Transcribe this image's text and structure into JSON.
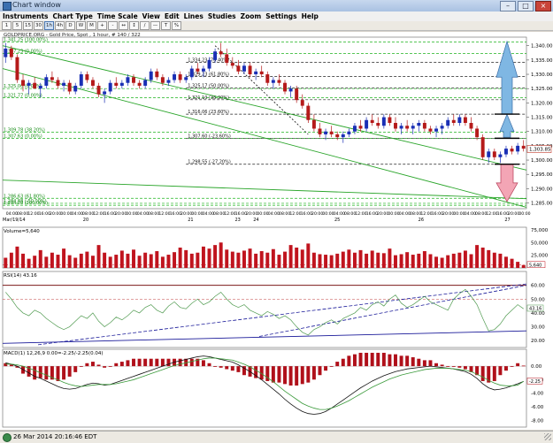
{
  "window": {
    "title": "Chart window",
    "buttons": [
      "–",
      "□",
      "×"
    ]
  },
  "menu": [
    "Instruments",
    "Chart Type",
    "Time Scale",
    "View",
    "Edit",
    "Lines",
    "Studies",
    "Zoom",
    "Settings",
    "Help"
  ],
  "toolbar": {
    "buttons": [
      "1",
      "5",
      "15",
      "30",
      "1h",
      "4h",
      "D",
      "W",
      "M",
      "+",
      "-",
      "↔",
      "↕",
      "/",
      "—",
      "T",
      "%"
    ],
    "selected": "1h"
  },
  "chart_data": [
    {
      "type": "candlestick",
      "title": "GOLDPRICE.ORG - Gold Price, Spot , 1 hour, # 140 / 322",
      "ylim": [
        1283,
        1343
      ],
      "yticks": [
        "1,340.00",
        "1,335.00",
        "1,330.00",
        "1,325.00",
        "1,320.00",
        "1,315.00",
        "1,310.00",
        "1,305.00",
        "1,300.00",
        "1,295.00",
        "1,290.00",
        "1,285.00"
      ],
      "ytick_values": [
        1340,
        1335,
        1330,
        1325,
        1320,
        1315,
        1310,
        1305,
        1300,
        1295,
        1290,
        1285
      ],
      "last_price": "1,303.85",
      "last_price_value": 1303.85,
      "x_ticks": [
        "04:00",
        "08:00",
        "12:00",
        "16:00",
        "20:00",
        "00:00",
        "04:00",
        "08:00",
        "12:00",
        "16:00",
        "20:00",
        "00:00",
        "04:00",
        "08:00",
        "12:00",
        "16:00",
        "20:00",
        "00:00",
        "04:00",
        "08:00",
        "12:00",
        "16:00",
        "20:00",
        "00:00",
        "04:00",
        "08:00",
        "12:00",
        "16:00",
        "20:00",
        "00:00",
        "04:00",
        "08:00",
        "12:00",
        "16:00",
        "20:00",
        "00:00",
        "04:00",
        "08:00",
        "12:00",
        "16:00",
        "20:00",
        "00:00",
        "04:00",
        "08:00",
        "12:00",
        "16:00",
        "20:00",
        "00:00"
      ],
      "date_labels": [
        "Mar/19/14",
        "20",
        "21",
        "23",
        "24",
        "25",
        "26",
        "27"
      ],
      "fib_lines": [
        {
          "value": 1341.25,
          "label": "1,341.25 (100.00%)"
        },
        {
          "value": 1337.23,
          "label": "1,337.23 (0.00%)"
        },
        {
          "value": 1334.23,
          "label": "1,334.23 (76.40%)"
        },
        {
          "value": 1329.23,
          "label": "1,329.23 (61.80%)"
        },
        {
          "value": 1325.17,
          "label": "1,325.17 (50.00%)"
        },
        {
          "value": 1325.0,
          "label": "1,325.00 (0.00%)"
        },
        {
          "value": 1321.77,
          "label": "1,321.77 (0.00%)"
        },
        {
          "value": 1321.1,
          "label": "1,321.10 (38.20%)"
        },
        {
          "value": 1316.06,
          "label": "1,316.06 (23.60%)"
        },
        {
          "value": 1309.78,
          "label": "1,309.78 (38.20%)"
        },
        {
          "value": 1307.63,
          "label": "1,307.63 (0.00%)"
        },
        {
          "value": 1307.6,
          "label": "1,307.60 (-23.60%)"
        },
        {
          "value": 1298.55,
          "label": "1,298.55 (-27.20%)"
        },
        {
          "value": 1286.63,
          "label": "1,286.63 (61.80%)"
        },
        {
          "value": 1284.88,
          "label": "1,284.88 (-50.00%)"
        },
        {
          "value": 1284.2,
          "label": "1,284.20 (100.00%)"
        }
      ],
      "candles": [
        [
          1336,
          1341,
          1334,
          1339
        ],
        [
          1339,
          1340,
          1335,
          1336
        ],
        [
          1336,
          1337,
          1327,
          1328
        ],
        [
          1328,
          1330,
          1324,
          1326
        ],
        [
          1326,
          1328,
          1323,
          1327
        ],
        [
          1327,
          1329,
          1325,
          1325
        ],
        [
          1325,
          1327,
          1322,
          1326
        ],
        [
          1326,
          1330,
          1325,
          1329
        ],
        [
          1329,
          1331,
          1327,
          1328
        ],
        [
          1328,
          1329,
          1325,
          1326
        ],
        [
          1326,
          1328,
          1324,
          1327
        ],
        [
          1327,
          1328,
          1323,
          1324
        ],
        [
          1324,
          1327,
          1323,
          1326
        ],
        [
          1326,
          1331,
          1325,
          1330
        ],
        [
          1330,
          1331,
          1327,
          1328
        ],
        [
          1328,
          1329,
          1325,
          1326
        ],
        [
          1326,
          1327,
          1322,
          1323
        ],
        [
          1323,
          1325,
          1320,
          1324
        ],
        [
          1324,
          1328,
          1323,
          1327
        ],
        [
          1327,
          1329,
          1325,
          1326
        ],
        [
          1326,
          1328,
          1325,
          1327
        ],
        [
          1327,
          1330,
          1326,
          1329
        ],
        [
          1329,
          1330,
          1326,
          1327
        ],
        [
          1327,
          1328,
          1325,
          1326
        ],
        [
          1326,
          1329,
          1325,
          1328
        ],
        [
          1328,
          1332,
          1327,
          1331
        ],
        [
          1331,
          1332,
          1328,
          1329
        ],
        [
          1329,
          1330,
          1326,
          1327
        ],
        [
          1327,
          1329,
          1326,
          1328
        ],
        [
          1328,
          1331,
          1327,
          1330
        ],
        [
          1330,
          1331,
          1327,
          1328
        ],
        [
          1328,
          1330,
          1327,
          1329
        ],
        [
          1329,
          1333,
          1328,
          1332
        ],
        [
          1332,
          1334,
          1330,
          1331
        ],
        [
          1331,
          1333,
          1329,
          1332
        ],
        [
          1332,
          1336,
          1331,
          1335
        ],
        [
          1335,
          1339,
          1334,
          1338
        ],
        [
          1338,
          1341,
          1336,
          1337
        ],
        [
          1337,
          1339,
          1333,
          1334
        ],
        [
          1334,
          1336,
          1332,
          1333
        ],
        [
          1333,
          1335,
          1330,
          1331
        ],
        [
          1331,
          1334,
          1330,
          1333
        ],
        [
          1333,
          1334,
          1329,
          1330
        ],
        [
          1330,
          1332,
          1328,
          1331
        ],
        [
          1331,
          1333,
          1329,
          1330
        ],
        [
          1330,
          1331,
          1326,
          1327
        ],
        [
          1327,
          1329,
          1325,
          1328
        ],
        [
          1328,
          1330,
          1326,
          1327
        ],
        [
          1327,
          1328,
          1323,
          1324
        ],
        [
          1324,
          1326,
          1322,
          1325
        ],
        [
          1325,
          1326,
          1320,
          1321
        ],
        [
          1321,
          1323,
          1318,
          1319
        ],
        [
          1319,
          1320,
          1313,
          1314
        ],
        [
          1314,
          1316,
          1310,
          1311
        ],
        [
          1311,
          1313,
          1308,
          1309
        ],
        [
          1309,
          1311,
          1307,
          1310
        ],
        [
          1310,
          1312,
          1308,
          1309
        ],
        [
          1309,
          1310,
          1307,
          1308
        ],
        [
          1308,
          1310,
          1306,
          1309
        ],
        [
          1309,
          1311,
          1308,
          1310
        ],
        [
          1310,
          1313,
          1309,
          1312
        ],
        [
          1312,
          1314,
          1310,
          1311
        ],
        [
          1311,
          1315,
          1310,
          1314
        ],
        [
          1314,
          1316,
          1312,
          1313
        ],
        [
          1313,
          1315,
          1311,
          1312
        ],
        [
          1312,
          1316,
          1311,
          1315
        ],
        [
          1315,
          1316,
          1312,
          1313
        ],
        [
          1313,
          1315,
          1310,
          1311
        ],
        [
          1311,
          1313,
          1309,
          1312
        ],
        [
          1312,
          1314,
          1310,
          1311
        ],
        [
          1311,
          1313,
          1309,
          1312
        ],
        [
          1312,
          1314,
          1310,
          1313
        ],
        [
          1313,
          1314,
          1310,
          1311
        ],
        [
          1311,
          1312,
          1309,
          1310
        ],
        [
          1310,
          1312,
          1308,
          1311
        ],
        [
          1311,
          1313,
          1309,
          1312
        ],
        [
          1312,
          1315,
          1311,
          1314
        ],
        [
          1314,
          1316,
          1312,
          1313
        ],
        [
          1313,
          1316,
          1312,
          1315
        ],
        [
          1315,
          1316,
          1312,
          1313
        ],
        [
          1313,
          1315,
          1310,
          1311
        ],
        [
          1311,
          1312,
          1307,
          1308
        ],
        [
          1308,
          1309,
          1300,
          1301
        ],
        [
          1301,
          1304,
          1299,
          1303
        ],
        [
          1303,
          1304,
          1300,
          1301
        ],
        [
          1301,
          1303,
          1299,
          1302
        ],
        [
          1302,
          1305,
          1301,
          1304
        ],
        [
          1304,
          1305,
          1302,
          1303
        ],
        [
          1303,
          1306,
          1302,
          1305
        ],
        [
          1305,
          1307,
          1303,
          1304
        ]
      ]
    },
    {
      "type": "bar",
      "title": "Volume=5,640",
      "ylim": [
        0,
        80000
      ],
      "yticks": [
        "75,000",
        "50,000",
        "25,000"
      ],
      "ytick_values": [
        75000,
        50000,
        25000
      ],
      "last_label": "5,640",
      "last_value": 5640,
      "values": [
        20000,
        30000,
        42000,
        28000,
        18000,
        24000,
        35000,
        22000,
        30000,
        26000,
        38000,
        25000,
        20000,
        28000,
        32000,
        24000,
        45000,
        30000,
        22000,
        26000,
        34000,
        28000,
        36000,
        24000,
        30000,
        27000,
        33000,
        22000,
        26000,
        31000,
        40000,
        35000,
        28000,
        30000,
        42000,
        38000,
        45000,
        50000,
        36000,
        32000,
        30000,
        34000,
        38000,
        28000,
        33000,
        30000,
        37000,
        26000,
        32000,
        45000,
        40000,
        36000,
        48000,
        30000,
        27000,
        26000,
        25000,
        28000,
        32000,
        36000,
        30000,
        35000,
        28000,
        34000,
        30000,
        29000,
        38000,
        25000,
        27000,
        31000,
        26000,
        28000,
        33000,
        27000,
        22000,
        20000,
        25000,
        28000,
        30000,
        34000,
        27000,
        45000,
        40000,
        35000,
        30000,
        28000,
        22000,
        18000,
        12000,
        5640
      ]
    },
    {
      "type": "line",
      "title": "RSI(14) 43.16",
      "ylim": [
        15,
        70
      ],
      "yticks": [
        "60.00",
        "50.00",
        "40.00",
        "30.00",
        "20.00"
      ],
      "ytick_values": [
        60,
        50,
        40,
        30,
        20
      ],
      "last_label": "43.16",
      "last_value": 43.16,
      "values": [
        55,
        50,
        44,
        40,
        38,
        42,
        40,
        36,
        33,
        30,
        28,
        30,
        34,
        38,
        36,
        40,
        34,
        30,
        33,
        37,
        35,
        38,
        42,
        40,
        44,
        46,
        42,
        40,
        45,
        48,
        44,
        43,
        47,
        50,
        46,
        48,
        52,
        55,
        50,
        46,
        44,
        46,
        42,
        40,
        38,
        41,
        39,
        36,
        38,
        35,
        30,
        26,
        24,
        28,
        30,
        33,
        35,
        32,
        36,
        38,
        40,
        44,
        42,
        46,
        48,
        45,
        50,
        53,
        47,
        44,
        46,
        49,
        52,
        48,
        46,
        44,
        42,
        50,
        54,
        57,
        52,
        46,
        36,
        27,
        28,
        32,
        38,
        42,
        46,
        43
      ]
    },
    {
      "type": "line",
      "title": "MACD(1) 12,26,9 0.00=-2.25/-2.25(0.04)",
      "ylim": [
        -9,
        2.5
      ],
      "yticks": [
        "0.00",
        "-2.00",
        "-4.00",
        "-6.00",
        "-8.00"
      ],
      "ytick_values": [
        0,
        -2,
        -4,
        -6,
        -8
      ],
      "last_label": "-2.25",
      "last_value": -2.25,
      "series": [
        {
          "values": [
            0.5,
            0.3,
            0,
            -0.5,
            -1,
            -1.5,
            -1.8,
            -2.2,
            -2.6,
            -3,
            -3.3,
            -3.4,
            -3.3,
            -3,
            -2.7,
            -2.5,
            -2.6,
            -2.8,
            -2.7,
            -2.4,
            -2.1,
            -1.8,
            -1.5,
            -1.2,
            -0.9,
            -0.6,
            -0.3,
            0,
            0.3,
            0.6,
            0.8,
            1,
            1.2,
            1.4,
            1.5,
            1.4,
            1.2,
            1.0,
            0.8,
            0.6,
            0.2,
            -0.3,
            -0.8,
            -1.4,
            -2,
            -2.7,
            -3.4,
            -4.1,
            -4.9,
            -5.6,
            -6.2,
            -6.7,
            -7,
            -7.1,
            -7,
            -6.7,
            -6.2,
            -5.6,
            -5,
            -4.4,
            -3.8,
            -3.2,
            -2.7,
            -2.2,
            -1.8,
            -1.4,
            -1.1,
            -0.8,
            -0.6,
            -0.4,
            -0.3,
            -0.2,
            -0.1,
            0,
            -0.1,
            -0.2,
            -0.3,
            -0.4,
            -0.6,
            -0.8,
            -1.2,
            -1.8,
            -2.6,
            -3.2,
            -3.5,
            -3.4,
            -3.2,
            -2.9,
            -2.6,
            -2.25
          ]
        },
        {
          "values": [
            0.3,
            0.3,
            0.2,
            0,
            -0.3,
            -0.6,
            -1,
            -1.3,
            -1.7,
            -2,
            -2.4,
            -2.7,
            -2.9,
            -3,
            -2.9,
            -2.8,
            -2.7,
            -2.7,
            -2.7,
            -2.6,
            -2.4,
            -2.2,
            -2,
            -1.7,
            -1.4,
            -1.1,
            -0.8,
            -0.5,
            -0.2,
            0.1,
            0.3,
            0.5,
            0.7,
            0.9,
            1.1,
            1.2,
            1.2,
            1.1,
            1,
            0.9,
            0.6,
            0.3,
            -0.1,
            -0.6,
            -1.1,
            -1.7,
            -2.3,
            -3,
            -3.7,
            -4.3,
            -4.9,
            -5.5,
            -5.9,
            -6.2,
            -6.4,
            -6.4,
            -6.2,
            -5.9,
            -5.5,
            -5.1,
            -4.6,
            -4.1,
            -3.6,
            -3.1,
            -2.7,
            -2.3,
            -1.9,
            -1.6,
            -1.3,
            -1.1,
            -0.9,
            -0.7,
            -0.5,
            -0.4,
            -0.3,
            -0.3,
            -0.3,
            -0.4,
            -0.5,
            -0.6,
            -0.8,
            -1.2,
            -1.6,
            -2.1,
            -2.5,
            -2.8,
            -2.9,
            -2.9,
            -2.8,
            -2.25
          ]
        }
      ],
      "histogram": [
        0.2,
        0.1,
        -0.1,
        -0.5,
        -0.7,
        -0.9,
        -0.8,
        -0.9,
        -0.9,
        -1,
        -0.9,
        -0.7,
        -0.4,
        0,
        0.2,
        0.3,
        0.1,
        -0.1,
        0,
        0.2,
        0.3,
        0.4,
        0.5,
        0.5,
        0.5,
        0.5,
        0.5,
        0.5,
        0.5,
        0.5,
        0.5,
        0.5,
        0.5,
        0.5,
        0.4,
        0.2,
        0,
        -0.1,
        -0.2,
        -0.3,
        -0.4,
        -0.6,
        -0.7,
        -0.8,
        -0.9,
        -1,
        -1.1,
        -1.1,
        -1.2,
        -1.3,
        -1.3,
        -1.2,
        -1.1,
        -0.9,
        -0.6,
        -0.3,
        0,
        0.3,
        0.5,
        0.7,
        0.8,
        0.9,
        0.9,
        0.9,
        0.9,
        0.9,
        0.8,
        0.8,
        0.7,
        0.7,
        0.6,
        0.5,
        0.4,
        0.4,
        0.2,
        0.1,
        0,
        0,
        -0.1,
        -0.2,
        -0.4,
        -0.6,
        -1,
        -1.1,
        -1,
        -0.6,
        -0.3,
        0,
        0.2,
        0.04
      ]
    }
  ],
  "status": {
    "text": "26 Mar 2014 20:16:46 EDT"
  }
}
